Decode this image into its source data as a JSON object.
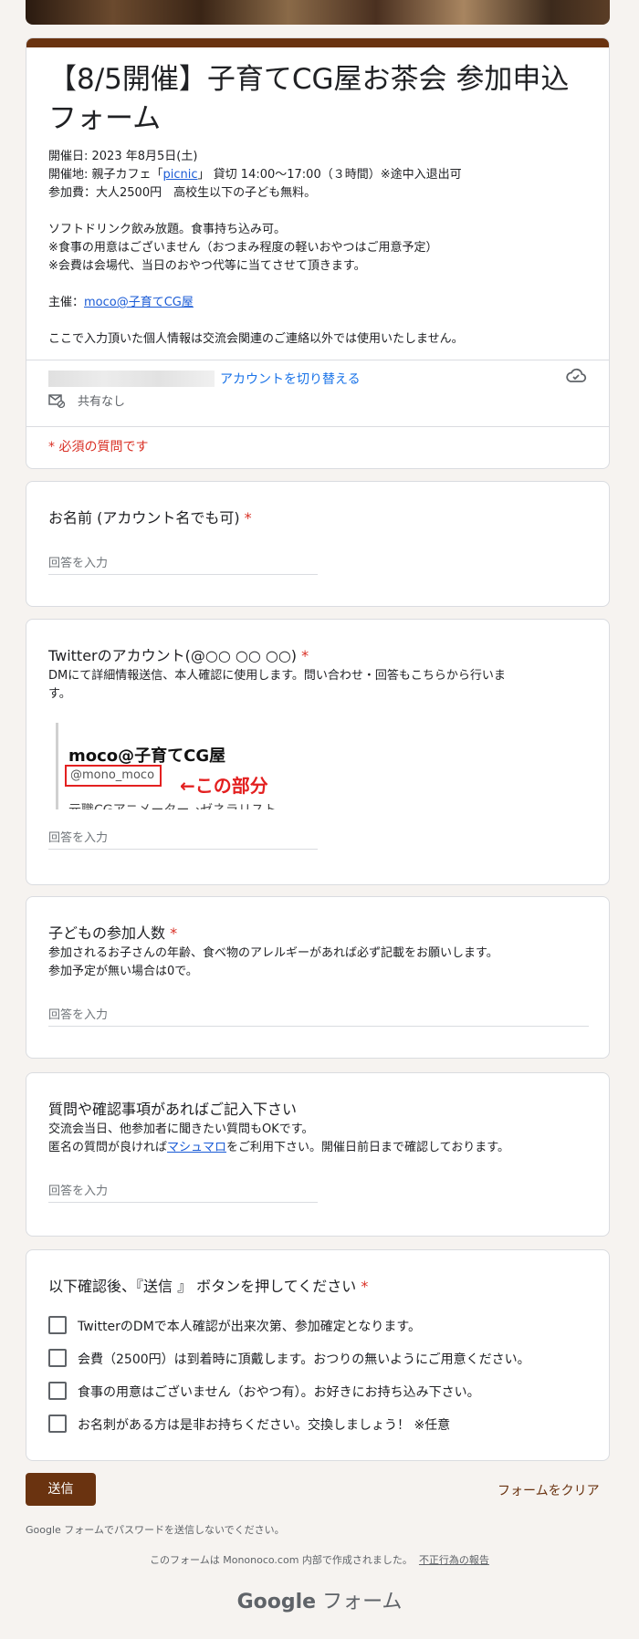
{
  "header": {
    "title": "【8/5開催】子育てCG屋お茶会 参加申込フォーム",
    "description": {
      "line1": "開催日: 2023 年8月5日(土)",
      "line2_prefix": "開催地: 親子カフェ「",
      "line2_link": "picnic",
      "line2_suffix": "」 貸切 14:00～17:00（３時間）※途中入退出可",
      "line3": "参加費：大人2500円　高校生以下の子ども無料。",
      "line4": "ソフトドリンク飲み放題。食事持ち込み可。",
      "line5": "※食事の用意はございません（おつまみ程度の軽いおやつはご用意予定）",
      "line6": "※会費は会場代、当日のおやつ代等に当てさせて頂きます。",
      "line7_prefix": "主催：",
      "line7_link": "moco@子育てCG屋",
      "line8": "ここで入力頂いた個人情報は交流会関連のご連絡以外では使用いたしません。"
    },
    "switch_account": "アカウントを切り替える",
    "share_status": "共有なし",
    "required_note": "* 必須の質問です"
  },
  "questions": {
    "q1": {
      "title": "お名前 (アカウント名でも可)",
      "star": "*",
      "placeholder": "回答を入力"
    },
    "q2": {
      "title": "Twitterのアカウント(@○○ ○○ ○○)",
      "star": "*",
      "desc1": "DMにて詳細情報送信、本人確認に使用します。問い合わせ・回答もこちらから行いま",
      "desc2": "す。",
      "image": {
        "name": "moco@子育てCG屋",
        "handle": "@mono_moco",
        "arrow_note": "←この部分",
        "cut_text": "元職CGアニメーター→ゼネラリスト"
      },
      "placeholder": "回答を入力"
    },
    "q3": {
      "title": "子どもの参加人数",
      "star": "*",
      "desc1": "参加されるお子さんの年齢、食べ物のアレルギーがあれば必ず記載をお願いします。",
      "desc2": "参加予定が無い場合は0で。",
      "placeholder": "回答を入力"
    },
    "q4": {
      "title": "質問や確認事項があればご記入下さい",
      "desc1": "交流会当日、他参加者に聞きたい質問もOKです。",
      "desc2_prefix": "匿名の質問が良ければ",
      "desc2_link": "マシュマロ",
      "desc2_suffix": "をご利用下さい。開催日前日まで確認しております。",
      "placeholder": "回答を入力"
    },
    "q5": {
      "title": "以下確認後、『送信 』 ボタンを押してください",
      "star": "*",
      "options": [
        "TwitterのDMで本人確認が出来次第、参加確定となります。",
        "会費（2500円）は到着時に頂戴します。おつりの無いようにご用意ください。",
        "食事の用意はございません（おやつ有）。お好きにお持ち込み下さい。",
        "お名刺がある方は是非お持ちください。交換しましょう！ ※任意"
      ]
    }
  },
  "footer": {
    "submit": "送信",
    "clear": "フォームをクリア",
    "password_note": "Google フォームでパスワードを送信しないでください。",
    "made_with": "このフォームは Mononoco.com 内部で作成されました。",
    "report_abuse": "不正行為の報告",
    "brand_google": "Google",
    "brand_forms": "フォーム"
  },
  "colors": {
    "theme": "#6a3310",
    "background": "#f6f3f0",
    "required": "#d93025",
    "link": "#1a5bd6"
  }
}
